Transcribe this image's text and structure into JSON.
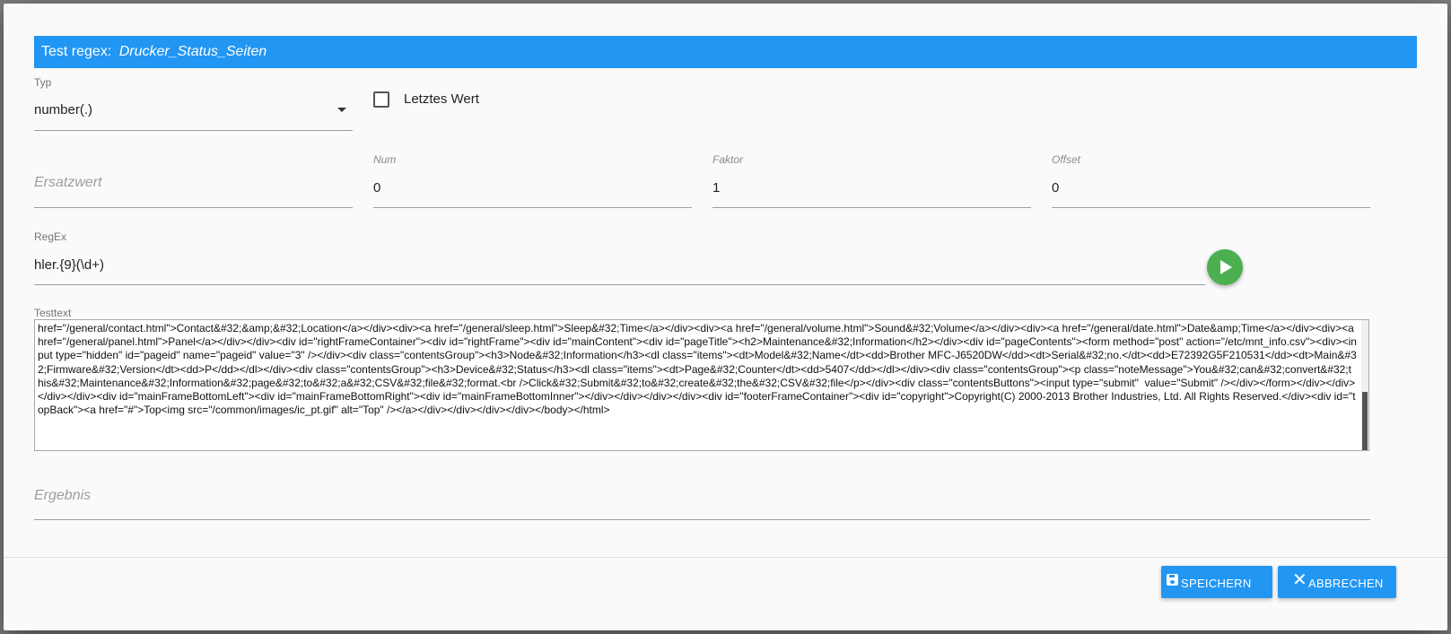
{
  "dialog": {
    "title_prefix": "Test regex:",
    "title_name": "Drucker_Status_Seiten"
  },
  "form": {
    "typ": {
      "label": "Typ",
      "value": "number(.)"
    },
    "letztes_wert": {
      "label": "Letztes Wert",
      "checked": false
    },
    "ersatzwert": {
      "placeholder": "Ersatzwert"
    },
    "num": {
      "label": "Num",
      "value": "0"
    },
    "faktor": {
      "label": "Faktor",
      "value": "1"
    },
    "offset": {
      "label": "Offset",
      "value": "0"
    },
    "regex": {
      "label": "RegEx",
      "value": "hler.{9}(\\d+)"
    },
    "testtext": {
      "label": "Testtext",
      "value": "href=\"/general/contact.html\">Contact&#32;&amp;&#32;Location</a></div><div><a href=\"/general/sleep.html\">Sleep&#32;Time</a></div><div><a href=\"/general/volume.html\">Sound&#32;Volume</a></div><div><a href=\"/general/date.html\">Date&amp;Time</a></div><div><a href=\"/general/panel.html\">Panel</a></div></div><div id=\"rightFrameContainer\"><div id=\"rightFrame\"><div id=\"mainContent\"><div id=\"pageTitle\"><h2>Maintenance&#32;Information</h2></div><div id=\"pageContents\"><form method=\"post\" action=\"/etc/mnt_info.csv\"><div><input type=\"hidden\" id=\"pageid\" name=\"pageid\" value=\"3\" /></div><div class=\"contentsGroup\"><h3>Node&#32;Information</h3><dl class=\"items\"><dt>Model&#32;Name</dt><dd>Brother MFC-J6520DW</dd><dt>Serial&#32;no.</dt><dd>E72392G5F210531</dd><dt>Main&#32;Firmware&#32;Version</dt><dd>P</dd></dl></div><div class=\"contentsGroup\"><h3>Device&#32;Status</h3><dl class=\"items\"><dt>Page&#32;Counter</dt><dd>5407</dd></dl></div><div class=\"contentsGroup\"><p class=\"noteMessage\">You&#32;can&#32;convert&#32;this&#32;Maintenance&#32;Information&#32;page&#32;to&#32;a&#32;CSV&#32;file&#32;format.<br />Click&#32;Submit&#32;to&#32;create&#32;the&#32;CSV&#32;file</p></div><div class=\"contentsButtons\"><input type=\"submit\"  value=\"Submit\" /></div></form></div></div></div></div><div id=\"mainFrameBottomLeft\"><div id=\"mainFrameBottomRight\"><div id=\"mainFrameBottomInner\"></div></div></div></div><div id=\"footerFrameContainer\"><div id=\"copyright\">Copyright(C) 2000-2013 Brother Industries, Ltd. All Rights Reserved.</div><div id=\"topBack\"><a href=\"#\">Top<img src=\"/common/images/ic_pt.gif\" alt=\"Top\" /></a></div></div></div></div></body></html>"
    },
    "ergebnis": {
      "placeholder": "Ergebnis"
    }
  },
  "actions": {
    "save_label": "SPEICHERN",
    "cancel_label": "ABBRECHEN"
  },
  "colors": {
    "primary": "#2196f3",
    "run": "#4caf50"
  }
}
